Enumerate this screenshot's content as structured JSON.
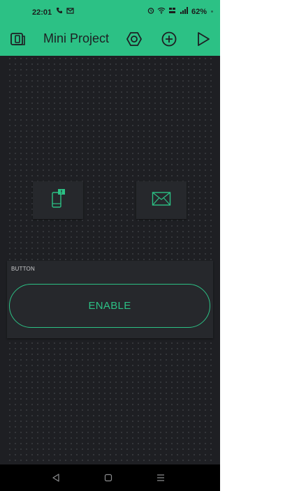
{
  "status_bar": {
    "time": "22:01",
    "icons_left": [
      "phone-call-icon",
      "mail-icon"
    ],
    "icons_right": [
      "alarm-icon",
      "wifi-icon",
      "volte-icon",
      "signal-icon"
    ],
    "battery": "62%"
  },
  "app_bar": {
    "title": "Mini Project",
    "icons": [
      "device-switch-icon",
      "settings-hexagon-icon",
      "add-widget-icon",
      "play-icon"
    ]
  },
  "canvas": {
    "widgets": [
      {
        "type": "notification",
        "icon": "phone-notification-icon"
      },
      {
        "type": "email",
        "icon": "envelope-icon"
      }
    ],
    "button_widget": {
      "label": "BUTTON",
      "button_text": "ENABLE"
    }
  },
  "nav_bar": {
    "buttons": [
      "back-icon",
      "home-icon",
      "recents-icon"
    ]
  },
  "colors": {
    "accent": "#2cc185",
    "background": "#1e1f23",
    "tile": "#26282c",
    "nav": "#000000"
  }
}
